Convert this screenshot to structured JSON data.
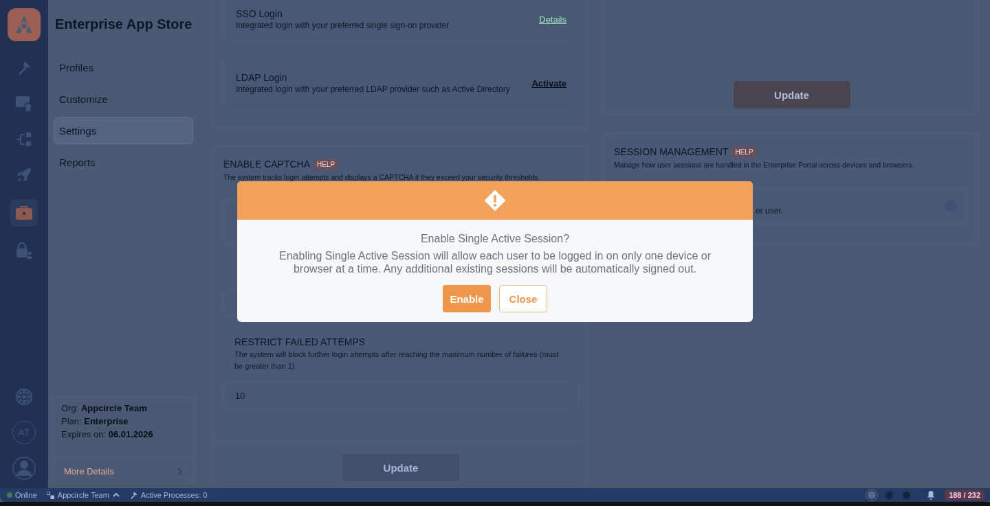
{
  "rail": {
    "items": [
      {
        "kind": "hammer",
        "selected": false
      },
      {
        "kind": "certificate",
        "selected": false
      },
      {
        "kind": "workflow",
        "selected": false
      },
      {
        "kind": "rocket",
        "selected": false
      },
      {
        "kind": "briefcase",
        "selected": true
      },
      {
        "kind": "lock-user",
        "selected": false
      }
    ],
    "bottom": [
      {
        "kind": "wheel"
      },
      {
        "kind": "initials",
        "text": "AT"
      },
      {
        "kind": "user"
      }
    ]
  },
  "app_title": "Enterprise App Store",
  "nav": [
    {
      "label": "Profiles",
      "selected": false
    },
    {
      "label": "Customize",
      "selected": false
    },
    {
      "label": "Settings",
      "selected": true
    },
    {
      "label": "Reports",
      "selected": false
    }
  ],
  "org_card": {
    "lines": [
      {
        "label": "Org:",
        "value": "Appcircle Team"
      },
      {
        "label": "Plan:",
        "value": "Enterprise"
      },
      {
        "label": "Expires on:",
        "value": "06.01.2026"
      }
    ],
    "more_link": "More Details"
  },
  "login_card": {
    "items": [
      {
        "title": "SSO Login",
        "description": "Integrated login with your preferred single sign-on provider",
        "action": "Details",
        "kind": "details"
      },
      {
        "title": "LDAP Login",
        "description": "Integrated login with your preferred LDAP provider such as Active Directory",
        "action": "Activate",
        "kind": "activate"
      }
    ]
  },
  "top_right_card": {
    "button": "Update"
  },
  "captcha_card": {
    "title": "ENABLE CAPTCHA",
    "badge": "HELP",
    "description": "The system tracks login attempts and displays a CAPTCHA if they exceed your security thresholds.",
    "restrict": {
      "title": "RESTRICT FAILED ATTEMPS",
      "description": "The system will block further login attempts after reaching the maximum number of failures (must be greater than 1).",
      "value": "10"
    },
    "button": "Update"
  },
  "session_card": {
    "title": "SESSION MANAGEMENT",
    "badge": "HELP",
    "description": "Manage how user sessions are handled in the Enterprise Portal across devices and browsers.",
    "option": {
      "description": "er user.",
      "on": true
    }
  },
  "status_bar": {
    "online": "Online",
    "team": "Appcircle Team",
    "processes": "Active Processes: 0",
    "count": "188 / 232"
  },
  "dialog": {
    "title": "Enable Single Active Session?",
    "message": "Enabling Single Active Session will allow each user to be logged in on only one device or browser at a time. Any additional existing sessions will be automatically signed out.",
    "buttons": [
      {
        "label": "Enable",
        "kind": "primary"
      },
      {
        "label": "Close",
        "kind": "secondary"
      }
    ]
  }
}
